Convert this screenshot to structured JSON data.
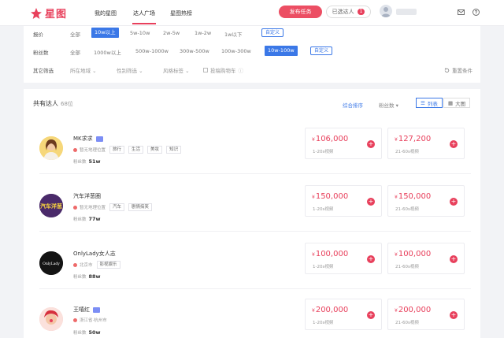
{
  "header": {
    "logo_text": "星图",
    "nav": [
      {
        "label": "我的星图"
      },
      {
        "label": "达人广场"
      },
      {
        "label": "星图热榜"
      }
    ],
    "publish_button": "发布任务",
    "selected_button": "已选达人",
    "selected_count": "1",
    "accent_color": "#e8405c"
  },
  "filters": {
    "price": {
      "label": "报价",
      "options": [
        "全部",
        "10w以上",
        "5w-10w",
        "2w-5w",
        "1w-2w",
        "1w以下"
      ],
      "selected": "10w以上",
      "custom": "自定义"
    },
    "fans": {
      "label": "粉丝数",
      "options": [
        "全部",
        "1000w以上",
        "500w-1000w",
        "300w-500w",
        "100w-300w",
        "10w-100w"
      ],
      "selected": "10w-100w",
      "custom": "自定义"
    },
    "other": {
      "label": "其它筛选",
      "dropdowns": [
        "所在地域",
        "性别筛选",
        "风格标签"
      ],
      "checkbox": "投稿购物车",
      "reset": "重置条件"
    }
  },
  "results": {
    "title": "共有达人",
    "count": "68位",
    "sort_primary": "综合排序",
    "sort_secondary": "粉丝数",
    "view_list": "列表",
    "view_grid": "大图",
    "fans_label": "粉丝数",
    "items": [
      {
        "name": "MK求求",
        "location": "暂无地理位置",
        "tags": [
          "旅行",
          "生活",
          "美妆",
          "知识"
        ],
        "fans": "51w",
        "price1": "106,000",
        "price1_desc": "1-20s视频",
        "price2": "127,200",
        "price2_desc": "21-60s视频",
        "avatar_text": ""
      },
      {
        "name": "汽车洋葱圈",
        "location": "暂无地理位置",
        "tags": [
          "汽车",
          "剧情搞笑"
        ],
        "fans": "77w",
        "price1": "150,000",
        "price1_desc": "1-20s视频",
        "price2": "150,000",
        "price2_desc": "21-60s视频",
        "avatar_text": "汽车洋葱"
      },
      {
        "name": "OnlyLady女人志",
        "location": "北京市",
        "tags": [
          "影视娱乐"
        ],
        "fans": "88w",
        "price1": "100,000",
        "price1_desc": "1-20s视频",
        "price2": "100,000",
        "price2_desc": "21-60s视频",
        "avatar_text": "OnlyLady"
      },
      {
        "name": "王嘻红",
        "location": "浙江省·杭州市",
        "tags": [],
        "fans": "50w",
        "price1": "200,000",
        "price1_desc": "1-20s视频",
        "price2": "200,000",
        "price2_desc": "21-60s视频",
        "avatar_text": ""
      }
    ],
    "currency": "¥"
  }
}
